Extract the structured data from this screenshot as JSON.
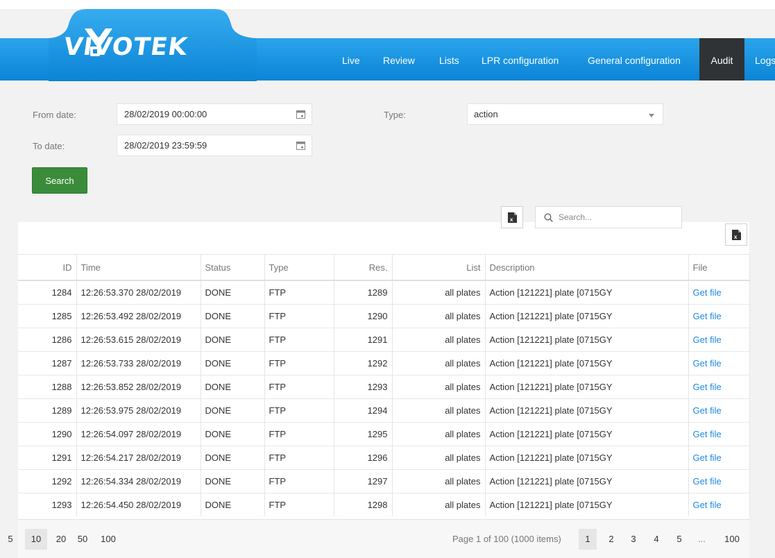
{
  "brand": {
    "name": "VIVOTEK",
    "blue": "#1a93e0",
    "nav_active_bg": "#2f3336",
    "button_green": "#3a8c3a",
    "link_color": "#1e88e5"
  },
  "nav": {
    "items": [
      {
        "label": "Live"
      },
      {
        "label": "Review"
      },
      {
        "label": "Lists"
      },
      {
        "label": "LPR configuration"
      },
      {
        "label": "General configuration"
      },
      {
        "label": "Audit",
        "active": true
      },
      {
        "label": "Logs"
      }
    ]
  },
  "filters": {
    "from_label": "From date:",
    "from_value": "28/02/2019 00:00:00",
    "to_label": "To date:",
    "to_value": "28/02/2019 23:59:59",
    "type_label": "Type:",
    "type_value": "action",
    "search_button": "Search"
  },
  "toolbar": {
    "search_placeholder": "Search...",
    "export_icon": "excel-export-icon",
    "search_icon": "magnifier-icon",
    "calendar_icon": "calendar-icon"
  },
  "table": {
    "columns": [
      "ID",
      "Time",
      "Status",
      "Type",
      "Res.",
      "List",
      "Description",
      "File"
    ],
    "rows": [
      [
        "1284",
        "12:26:53.370 28/02/2019",
        "DONE",
        "FTP",
        "1289",
        "all plates",
        "Action [121221] plate [0715GY",
        "Get file"
      ],
      [
        "1285",
        "12:26:53.492 28/02/2019",
        "DONE",
        "FTP",
        "1290",
        "all plates",
        "Action [121221] plate [0715GY",
        "Get file"
      ],
      [
        "1286",
        "12:26:53.615 28/02/2019",
        "DONE",
        "FTP",
        "1291",
        "all plates",
        "Action [121221] plate [0715GY",
        "Get file"
      ],
      [
        "1287",
        "12:26:53.733 28/02/2019",
        "DONE",
        "FTP",
        "1292",
        "all plates",
        "Action [121221] plate [0715GY",
        "Get file"
      ],
      [
        "1288",
        "12:26:53.852 28/02/2019",
        "DONE",
        "FTP",
        "1293",
        "all plates",
        "Action [121221] plate [0715GY",
        "Get file"
      ],
      [
        "1289",
        "12:26:53.975 28/02/2019",
        "DONE",
        "FTP",
        "1294",
        "all plates",
        "Action [121221] plate [0715GY",
        "Get file"
      ],
      [
        "1290",
        "12:26:54.097 28/02/2019",
        "DONE",
        "FTP",
        "1295",
        "all plates",
        "Action [121221] plate [0715GY",
        "Get file"
      ],
      [
        "1291",
        "12:26:54.217 28/02/2019",
        "DONE",
        "FTP",
        "1296",
        "all plates",
        "Action [121221] plate [0715GY",
        "Get file"
      ],
      [
        "1292",
        "12:26:54.334 28/02/2019",
        "DONE",
        "FTP",
        "1297",
        "all plates",
        "Action [121221] plate [0715GY",
        "Get file"
      ],
      [
        "1293",
        "12:26:54.450 28/02/2019",
        "DONE",
        "FTP",
        "1298",
        "all plates",
        "Action [121221] plate [0715GY",
        "Get file"
      ]
    ]
  },
  "pager": {
    "page_sizes": [
      "5",
      "10",
      "20",
      "50",
      "100"
    ],
    "selected_page_size": "10",
    "info": "Page 1 of 100 (1000 items)",
    "pages": [
      "1",
      "2",
      "3",
      "4",
      "5"
    ],
    "current_page": "1",
    "ellipsis": "...",
    "last_page": "100"
  }
}
